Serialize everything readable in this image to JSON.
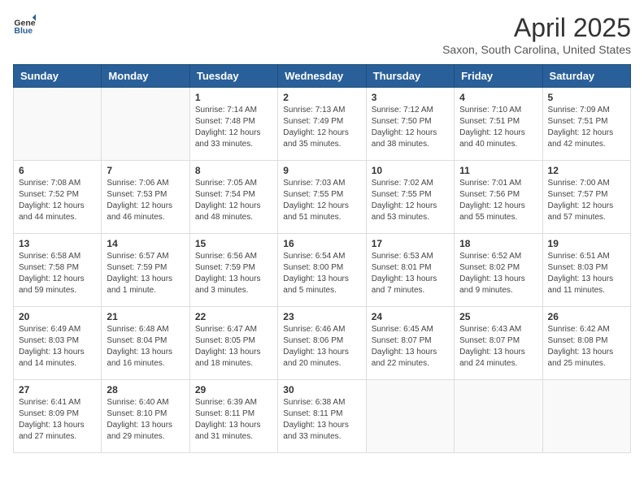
{
  "header": {
    "logo_general": "General",
    "logo_blue": "Blue",
    "title": "April 2025",
    "subtitle": "Saxon, South Carolina, United States"
  },
  "calendar": {
    "days_of_week": [
      "Sunday",
      "Monday",
      "Tuesday",
      "Wednesday",
      "Thursday",
      "Friday",
      "Saturday"
    ],
    "weeks": [
      [
        {
          "day": "",
          "info": ""
        },
        {
          "day": "",
          "info": ""
        },
        {
          "day": "1",
          "info": "Sunrise: 7:14 AM\nSunset: 7:48 PM\nDaylight: 12 hours and 33 minutes."
        },
        {
          "day": "2",
          "info": "Sunrise: 7:13 AM\nSunset: 7:49 PM\nDaylight: 12 hours and 35 minutes."
        },
        {
          "day": "3",
          "info": "Sunrise: 7:12 AM\nSunset: 7:50 PM\nDaylight: 12 hours and 38 minutes."
        },
        {
          "day": "4",
          "info": "Sunrise: 7:10 AM\nSunset: 7:51 PM\nDaylight: 12 hours and 40 minutes."
        },
        {
          "day": "5",
          "info": "Sunrise: 7:09 AM\nSunset: 7:51 PM\nDaylight: 12 hours and 42 minutes."
        }
      ],
      [
        {
          "day": "6",
          "info": "Sunrise: 7:08 AM\nSunset: 7:52 PM\nDaylight: 12 hours and 44 minutes."
        },
        {
          "day": "7",
          "info": "Sunrise: 7:06 AM\nSunset: 7:53 PM\nDaylight: 12 hours and 46 minutes."
        },
        {
          "day": "8",
          "info": "Sunrise: 7:05 AM\nSunset: 7:54 PM\nDaylight: 12 hours and 48 minutes."
        },
        {
          "day": "9",
          "info": "Sunrise: 7:03 AM\nSunset: 7:55 PM\nDaylight: 12 hours and 51 minutes."
        },
        {
          "day": "10",
          "info": "Sunrise: 7:02 AM\nSunset: 7:55 PM\nDaylight: 12 hours and 53 minutes."
        },
        {
          "day": "11",
          "info": "Sunrise: 7:01 AM\nSunset: 7:56 PM\nDaylight: 12 hours and 55 minutes."
        },
        {
          "day": "12",
          "info": "Sunrise: 7:00 AM\nSunset: 7:57 PM\nDaylight: 12 hours and 57 minutes."
        }
      ],
      [
        {
          "day": "13",
          "info": "Sunrise: 6:58 AM\nSunset: 7:58 PM\nDaylight: 12 hours and 59 minutes."
        },
        {
          "day": "14",
          "info": "Sunrise: 6:57 AM\nSunset: 7:59 PM\nDaylight: 13 hours and 1 minute."
        },
        {
          "day": "15",
          "info": "Sunrise: 6:56 AM\nSunset: 7:59 PM\nDaylight: 13 hours and 3 minutes."
        },
        {
          "day": "16",
          "info": "Sunrise: 6:54 AM\nSunset: 8:00 PM\nDaylight: 13 hours and 5 minutes."
        },
        {
          "day": "17",
          "info": "Sunrise: 6:53 AM\nSunset: 8:01 PM\nDaylight: 13 hours and 7 minutes."
        },
        {
          "day": "18",
          "info": "Sunrise: 6:52 AM\nSunset: 8:02 PM\nDaylight: 13 hours and 9 minutes."
        },
        {
          "day": "19",
          "info": "Sunrise: 6:51 AM\nSunset: 8:03 PM\nDaylight: 13 hours and 11 minutes."
        }
      ],
      [
        {
          "day": "20",
          "info": "Sunrise: 6:49 AM\nSunset: 8:03 PM\nDaylight: 13 hours and 14 minutes."
        },
        {
          "day": "21",
          "info": "Sunrise: 6:48 AM\nSunset: 8:04 PM\nDaylight: 13 hours and 16 minutes."
        },
        {
          "day": "22",
          "info": "Sunrise: 6:47 AM\nSunset: 8:05 PM\nDaylight: 13 hours and 18 minutes."
        },
        {
          "day": "23",
          "info": "Sunrise: 6:46 AM\nSunset: 8:06 PM\nDaylight: 13 hours and 20 minutes."
        },
        {
          "day": "24",
          "info": "Sunrise: 6:45 AM\nSunset: 8:07 PM\nDaylight: 13 hours and 22 minutes."
        },
        {
          "day": "25",
          "info": "Sunrise: 6:43 AM\nSunset: 8:07 PM\nDaylight: 13 hours and 24 minutes."
        },
        {
          "day": "26",
          "info": "Sunrise: 6:42 AM\nSunset: 8:08 PM\nDaylight: 13 hours and 25 minutes."
        }
      ],
      [
        {
          "day": "27",
          "info": "Sunrise: 6:41 AM\nSunset: 8:09 PM\nDaylight: 13 hours and 27 minutes."
        },
        {
          "day": "28",
          "info": "Sunrise: 6:40 AM\nSunset: 8:10 PM\nDaylight: 13 hours and 29 minutes."
        },
        {
          "day": "29",
          "info": "Sunrise: 6:39 AM\nSunset: 8:11 PM\nDaylight: 13 hours and 31 minutes."
        },
        {
          "day": "30",
          "info": "Sunrise: 6:38 AM\nSunset: 8:11 PM\nDaylight: 13 hours and 33 minutes."
        },
        {
          "day": "",
          "info": ""
        },
        {
          "day": "",
          "info": ""
        },
        {
          "day": "",
          "info": ""
        }
      ]
    ]
  }
}
